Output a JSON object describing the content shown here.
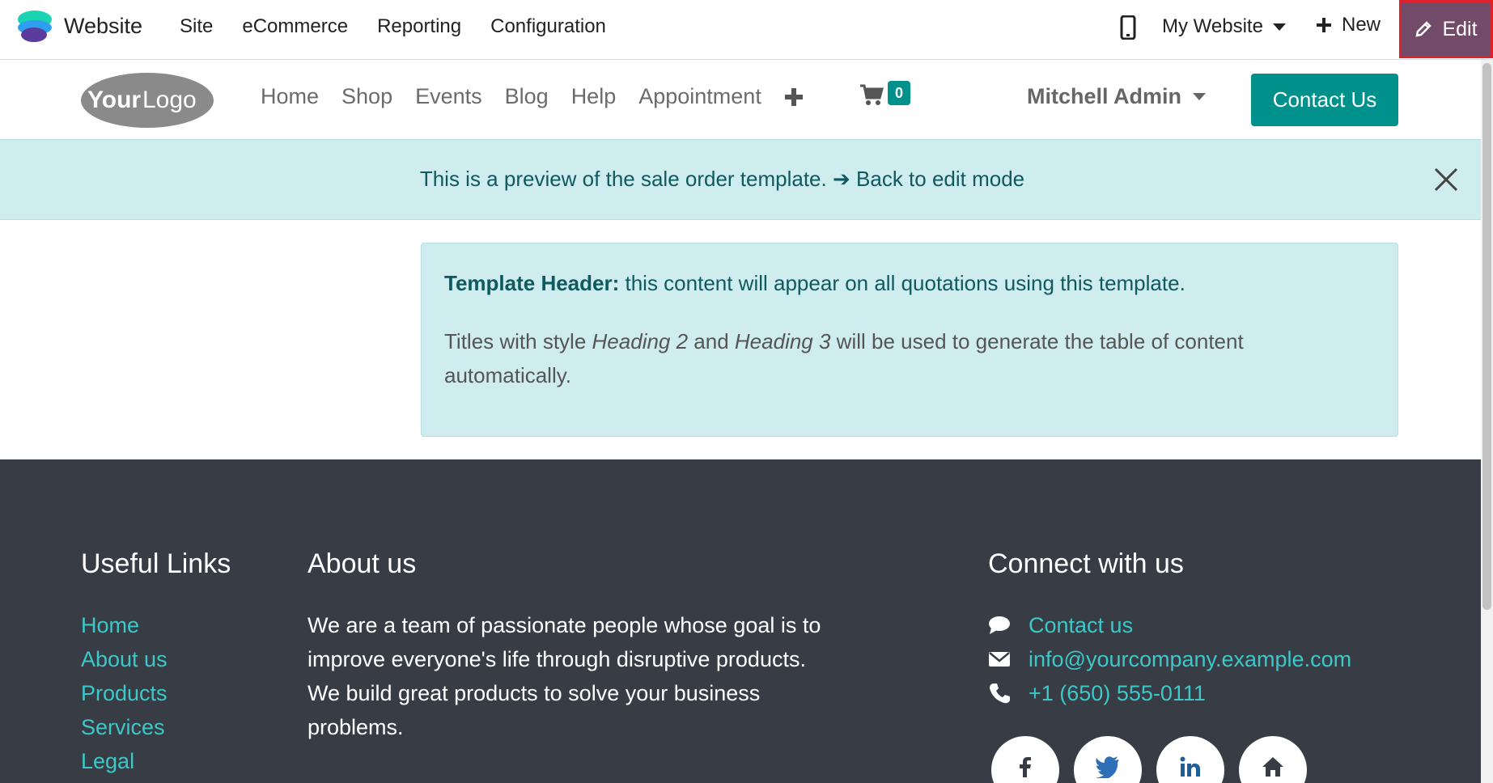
{
  "topbar": {
    "app_name": "Website",
    "menus": [
      "Site",
      "eCommerce",
      "Reporting",
      "Configuration"
    ],
    "website_selector": "My Website",
    "new_label": "New",
    "edit_label": "Edit",
    "colors": {
      "edit_bg": "#714b67",
      "edit_border": "#e0202a"
    }
  },
  "site_header": {
    "nav": [
      "Home",
      "Shop",
      "Events",
      "Blog",
      "Help",
      "Appointment"
    ],
    "cart_count": "0",
    "user_name": "Mitchell Admin",
    "contact_button": "Contact Us",
    "colors": {
      "primary": "#00918c"
    }
  },
  "banner": {
    "text": "This is a preview of the sale order template.",
    "arrow": "➔",
    "link": "Back to edit mode"
  },
  "template": {
    "header_bold": "Template Header:",
    "header_text": " this content will appear on all quotations using this template.",
    "line2_a": "Titles with style ",
    "line2_h2": "Heading 2",
    "line2_b": " and ",
    "line2_h3": "Heading 3",
    "line2_c": " will be used to generate the table of content automatically."
  },
  "footer": {
    "useful_links_title": "Useful Links",
    "useful_links": [
      "Home",
      "About us",
      "Products",
      "Services",
      "Legal"
    ],
    "about_title": "About us",
    "about_text": "We are a team of passionate people whose goal is to improve everyone's life through disruptive products. We build great products to solve your business problems.",
    "connect_title": "Connect with us",
    "contact_link": "Contact us",
    "email": "info@yourcompany.example.com",
    "phone": "+1 (650) 555-0111",
    "social_icons": [
      "facebook-icon",
      "twitter-icon",
      "linkedin-icon",
      "home-icon"
    ]
  }
}
